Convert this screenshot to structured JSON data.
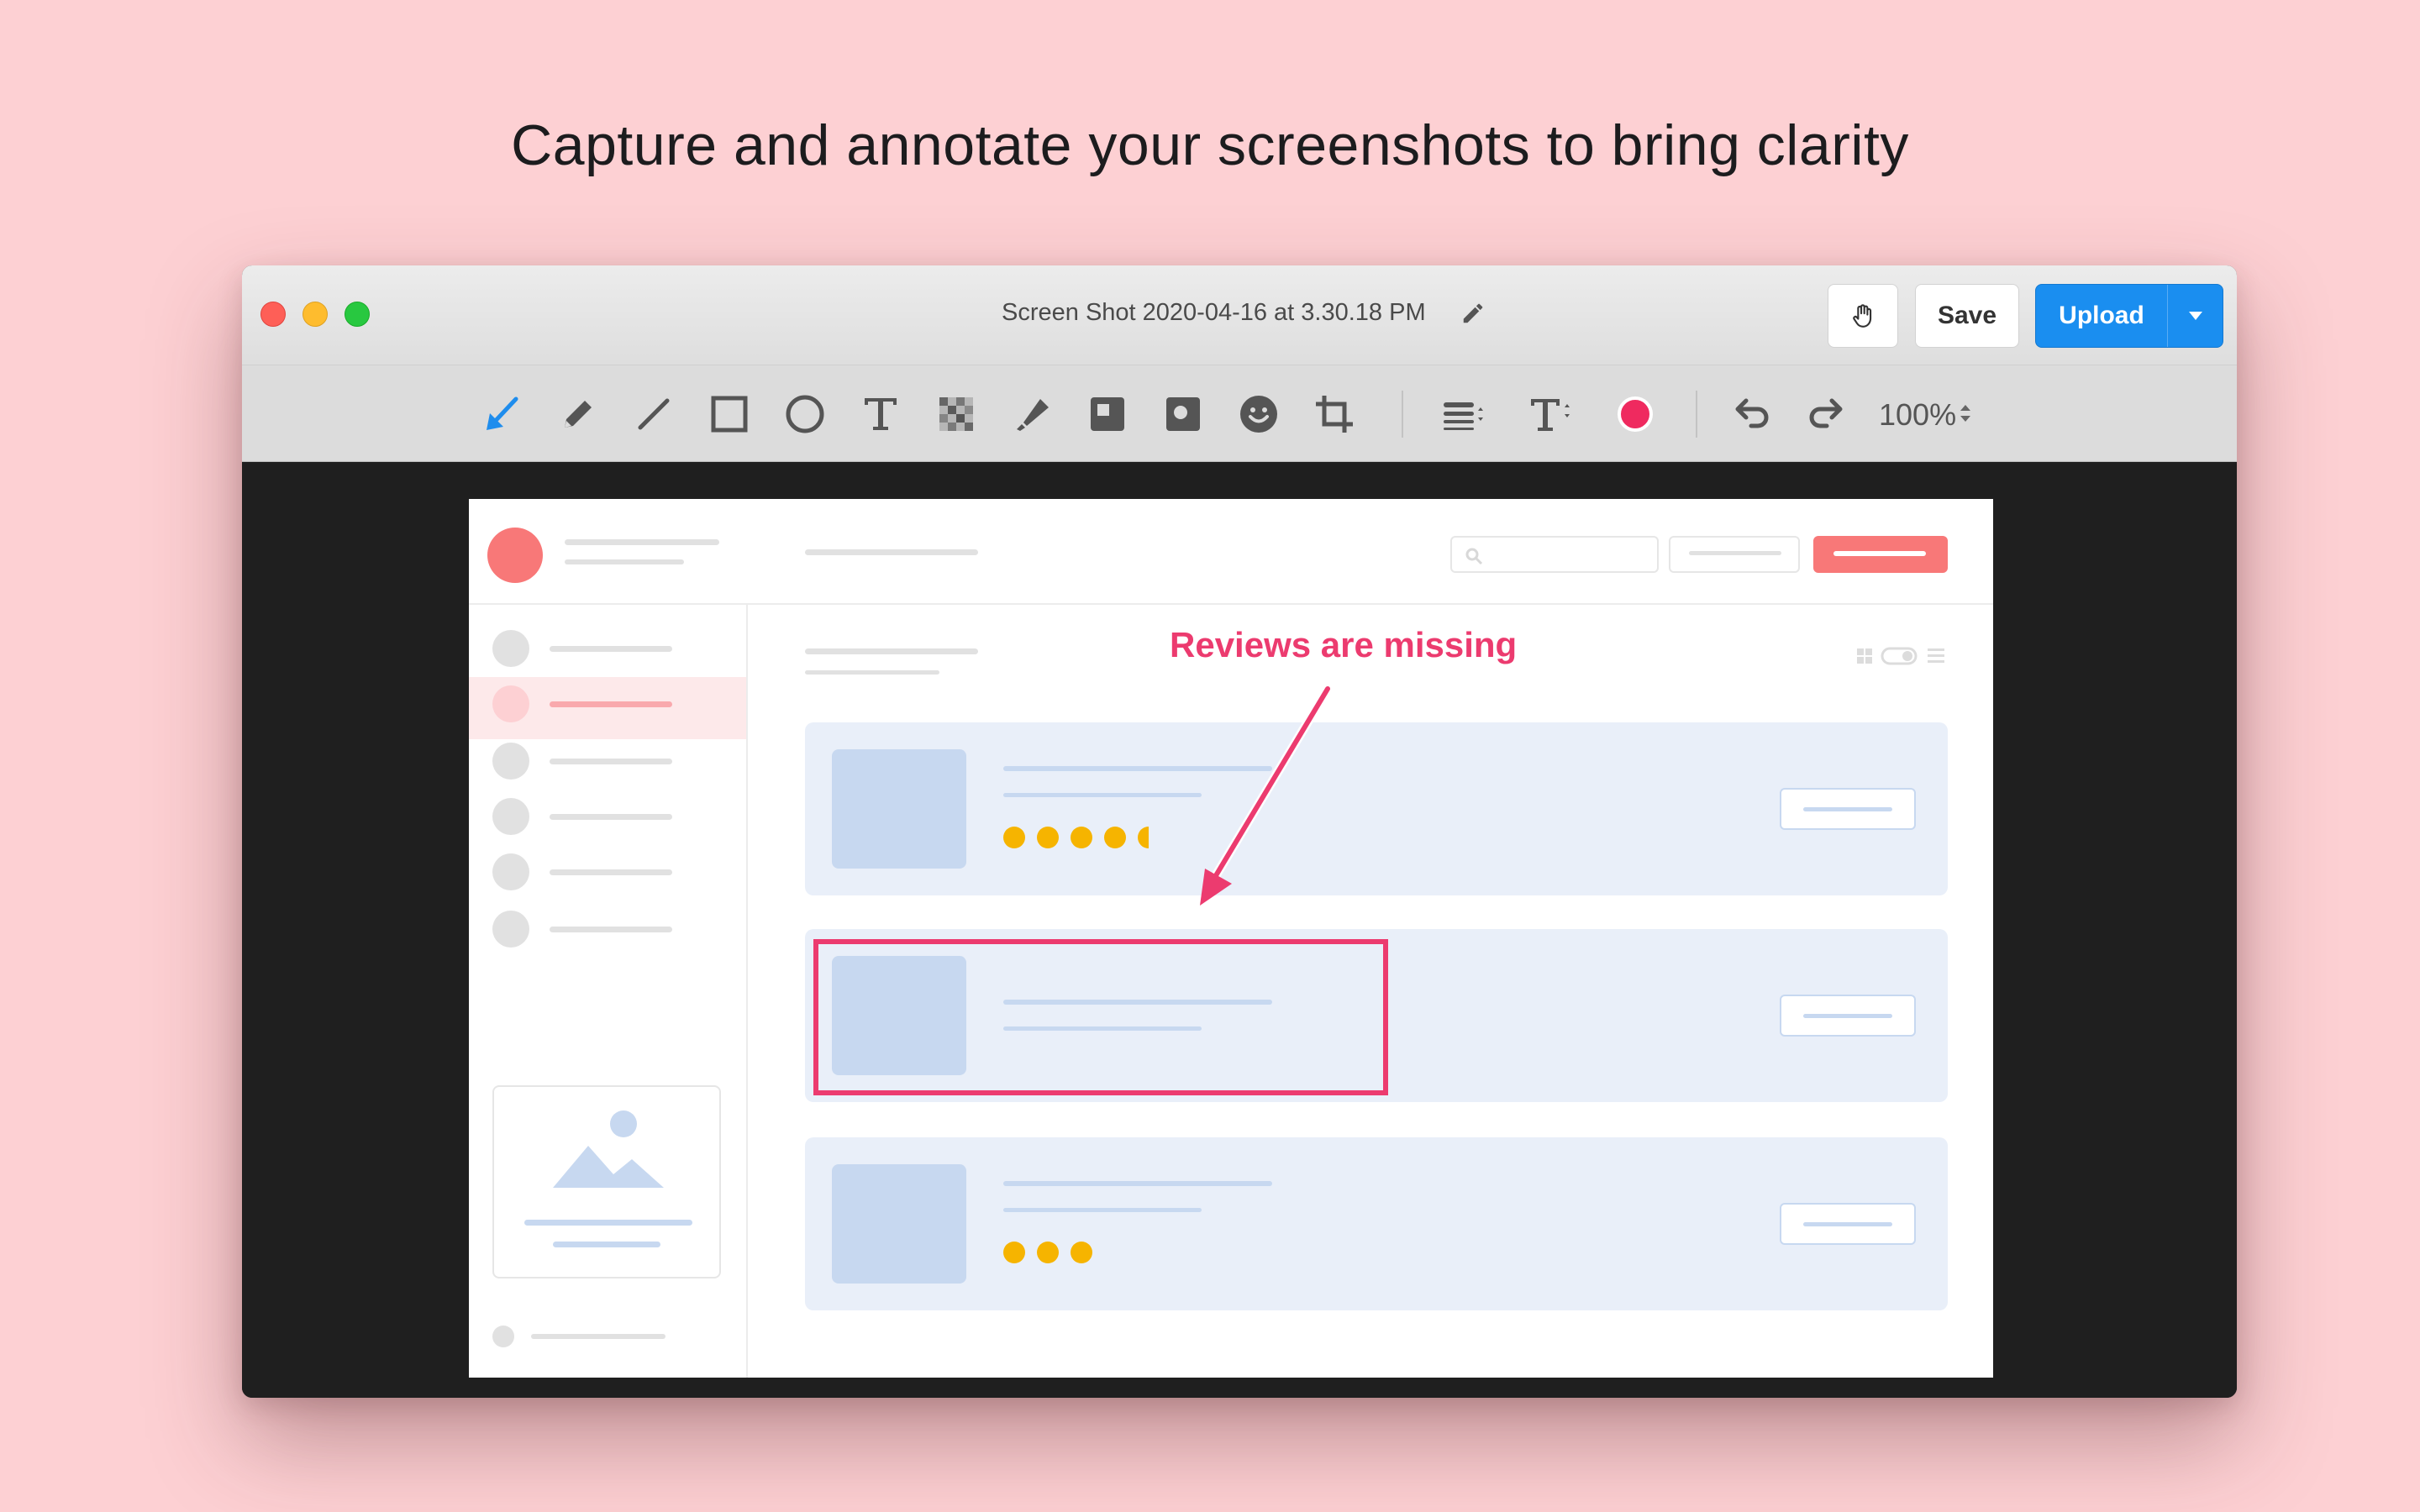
{
  "headline": "Capture and annotate your screenshots to bring clarity",
  "window": {
    "title": "Screen Shot 2020-04-16 at 3.30.18 PM",
    "buttons": {
      "save": "Save",
      "upload": "Upload"
    }
  },
  "toolbar": {
    "tools": [
      "arrow",
      "pencil",
      "line",
      "rectangle",
      "ellipse",
      "text",
      "pixelate",
      "highlighter",
      "counter-square",
      "counter-circle",
      "emoji",
      "crop"
    ],
    "active_tool": "arrow",
    "active_color": "#ef2a5f",
    "zoom": "100%"
  },
  "annotation": {
    "text": "Reviews are missing",
    "color": "#ec3b6f"
  },
  "mock_screenshot": {
    "cards": [
      {
        "rating_dots": 4.5
      },
      {
        "rating_dots": 0
      },
      {
        "rating_dots": 3
      }
    ]
  }
}
